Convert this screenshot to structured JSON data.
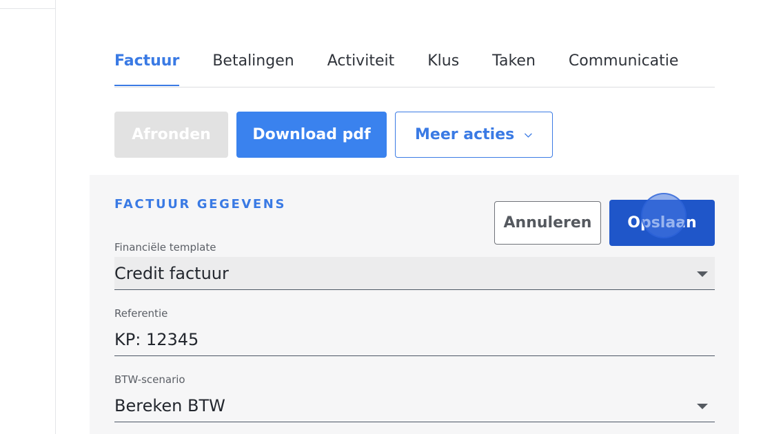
{
  "tabs": [
    {
      "label": "Factuur",
      "active": true
    },
    {
      "label": "Betalingen",
      "active": false
    },
    {
      "label": "Activiteit",
      "active": false
    },
    {
      "label": "Klus",
      "active": false
    },
    {
      "label": "Taken",
      "active": false
    },
    {
      "label": "Communicatie",
      "active": false
    }
  ],
  "actions": {
    "finish_label": "Afronden",
    "download_label": "Download pdf",
    "more_label": "Meer acties"
  },
  "panel": {
    "title": "FACTUUR GEGEVENS",
    "cancel_label": "Annuleren",
    "save_label": "Opslaan",
    "fields": {
      "template": {
        "label": "Financiële template",
        "value": "Credit factuur"
      },
      "reference": {
        "label": "Referentie",
        "value": "KP: 12345"
      },
      "vat": {
        "label": "BTW-scenario",
        "value": "Bereken BTW"
      }
    }
  },
  "colors": {
    "accent": "#3a7ae4",
    "primary_button": "#3a82ee",
    "save_button": "#1f56c9",
    "disabled_button": "#e2e2e2",
    "panel_background": "#f6f6f7"
  },
  "icons": {
    "more_actions": "chevron-down-icon",
    "select_caret": "caret-down-icon"
  }
}
